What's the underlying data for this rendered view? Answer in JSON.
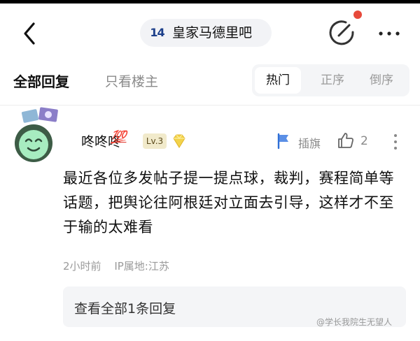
{
  "header": {
    "forum_badge": "14",
    "forum_name": "皇家马德里吧"
  },
  "tabs": {
    "all_replies": "全部回复",
    "owner_only": "只看楼主"
  },
  "sort": {
    "hot": "热门",
    "ascending": "正序",
    "descending": "倒序"
  },
  "comment": {
    "username": "咚咚咚",
    "emoji": "💯",
    "level": "Lv.3",
    "flag_label": "插旗",
    "like_count": "2",
    "body": "最近各位多发帖子提一提点球，裁判，赛程简单等话题，把舆论往阿根廷对立面去引导，这样才不至于输的太难看",
    "time": "2小时前",
    "ip_location": "IP属地:江苏",
    "view_replies": "查看全部1条回复"
  },
  "watermark": "@学长我院生无望人",
  "colors": {
    "notification_dot": "#e74a3b",
    "sort_background": "#f4f5f7",
    "muted_text": "#8a8a8a"
  },
  "icons": [
    "back-icon",
    "edit-icon",
    "more-icon",
    "diamond-icon",
    "flag-icon",
    "like-icon",
    "kebab-icon"
  ]
}
